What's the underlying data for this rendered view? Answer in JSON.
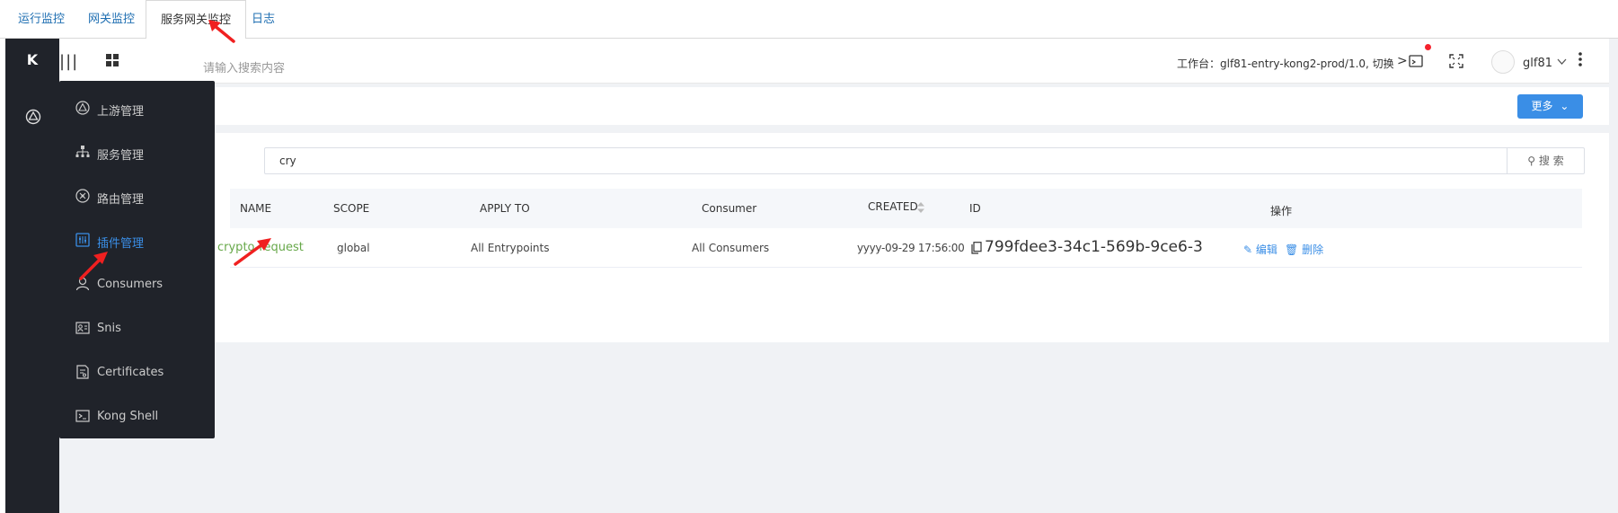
{
  "tabs": [
    {
      "label": "运行监控"
    },
    {
      "label": "网关监控"
    },
    {
      "label": "服务网关监控"
    },
    {
      "label": "日志"
    }
  ],
  "rail": {
    "logo": "K"
  },
  "toolbar": {
    "search_placeholder": "请输入搜索内容",
    "workspace": "工作台：glf81-entry-kong2-prod/1.0, 切换",
    "username": "glf81"
  },
  "subbar": {
    "more_label": "更多"
  },
  "filter": {
    "value": "cry",
    "button_label": "搜 索"
  },
  "table": {
    "columns": [
      "NAME",
      "SCOPE",
      "APPLY TO",
      "Consumer",
      "CREATED",
      "ID",
      "操作"
    ],
    "rows": [
      {
        "name": "crypto-request",
        "scope": "global",
        "apply_to": "All Entrypoints",
        "consumer": "All Consumers",
        "created": "yyyy-09-29 17:56:00",
        "id": "799fdee3-34c1-569b-9ce6-3",
        "edit": "编辑",
        "delete": "删除"
      }
    ]
  },
  "menu": {
    "items": [
      {
        "label": "上游管理",
        "icon": "upstream-icon"
      },
      {
        "label": "服务管理",
        "icon": "sitemap-icon"
      },
      {
        "label": "路由管理",
        "icon": "route-icon"
      },
      {
        "label": "插件管理",
        "icon": "plugin-icon"
      },
      {
        "label": "Consumers",
        "icon": "user-icon"
      },
      {
        "label": "Snis",
        "icon": "sni-icon"
      },
      {
        "label": "Certificates",
        "icon": "certificate-icon"
      },
      {
        "label": "Kong Shell",
        "icon": "terminal-icon"
      }
    ]
  },
  "colors": {
    "accent": "#3a8ee6",
    "menu_bg": "#20232a",
    "link_green": "#67a84a",
    "arrow_red": "#f02020"
  }
}
